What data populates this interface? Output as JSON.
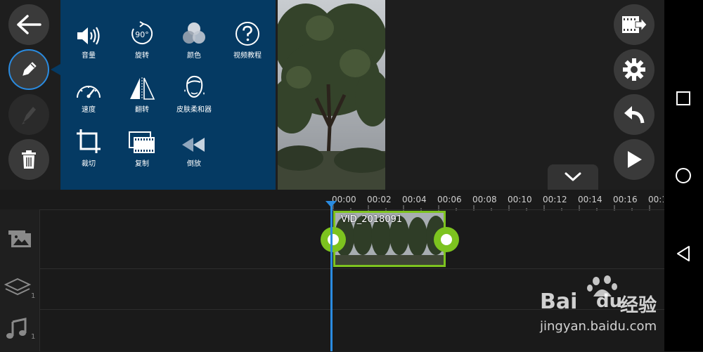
{
  "edit_panel": {
    "tools": [
      {
        "label": "音量",
        "icon": "volume-icon"
      },
      {
        "label": "旋转",
        "icon": "rotate-90-icon",
        "badge": "90°"
      },
      {
        "label": "颜色",
        "icon": "color-circles-icon"
      },
      {
        "label": "视频教程",
        "icon": "help-icon"
      },
      {
        "label": "速度",
        "icon": "speedometer-icon"
      },
      {
        "label": "翻转",
        "icon": "flip-icon"
      },
      {
        "label": "皮肤柔和器",
        "icon": "face-icon"
      },
      {
        "label": "裁切",
        "icon": "crop-icon"
      },
      {
        "label": "复制",
        "icon": "duplicate-icon"
      },
      {
        "label": "倒放",
        "icon": "reverse-icon"
      }
    ]
  },
  "timeline": {
    "ticks": [
      "00:00",
      "00:02",
      "00:04",
      "00:06",
      "00:08",
      "00:10",
      "00:12",
      "00:14",
      "00:16",
      "00:1"
    ],
    "clip_name": "VID_2018091",
    "layer_count": "1",
    "audio_count": "1"
  },
  "watermark": {
    "brand": "Bai",
    "brand2": "du",
    "cn": "经验",
    "url": "jingyan.baidu.com"
  },
  "colors": {
    "panel_bg": "#053a63",
    "accent_blue": "#2a8be0",
    "clip_green": "#7dc31f",
    "button_bg": "#3a3a3a"
  }
}
